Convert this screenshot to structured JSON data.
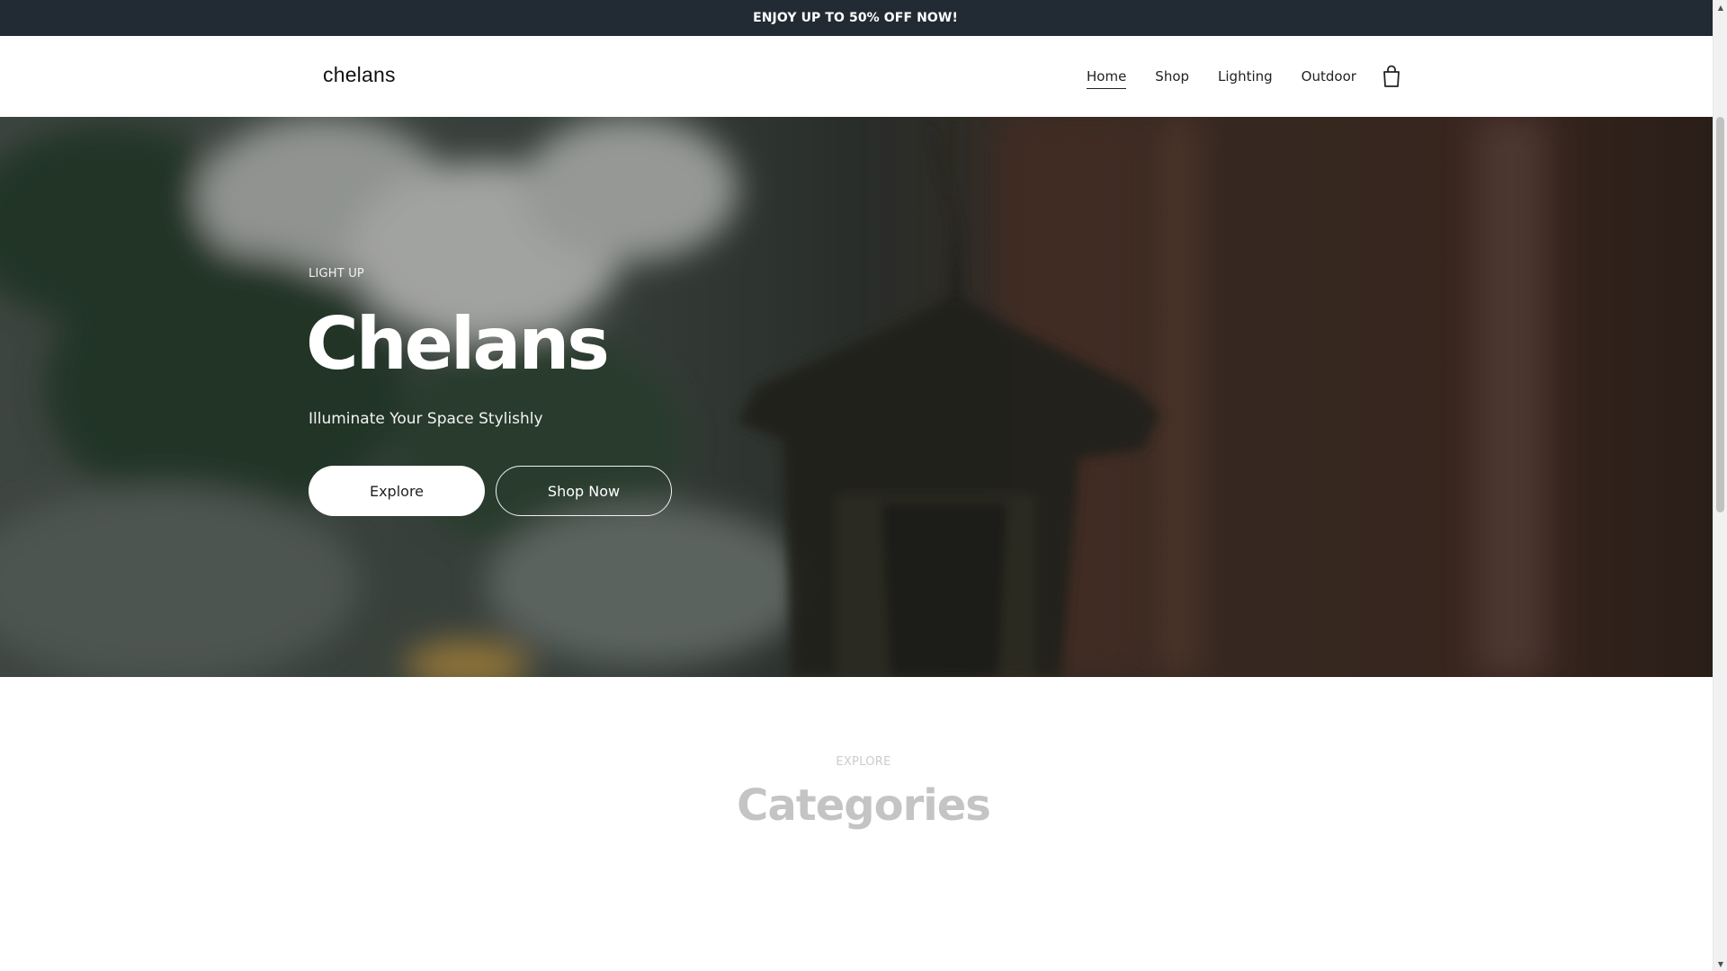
{
  "announcement": {
    "text": "ENJOY UP TO 50% OFF NOW!"
  },
  "header": {
    "logo": "chelans",
    "nav": [
      {
        "label": "Home",
        "active": true
      },
      {
        "label": "Shop",
        "active": false
      },
      {
        "label": "Lighting",
        "active": false
      },
      {
        "label": "Outdoor",
        "active": false
      }
    ],
    "cart_icon": "shopping-bag-icon"
  },
  "hero": {
    "eyebrow": "LIGHT UP",
    "title": "Chelans",
    "subtitle": "Illuminate Your Space Stylishly",
    "buttons": {
      "explore": "Explore",
      "shop_now": "Shop Now"
    }
  },
  "categories": {
    "eyebrow": "EXPLORE",
    "title": "Categories"
  },
  "colors": {
    "announcement_bg": "#222b33",
    "header_bg": "#ffffff",
    "text_dark": "#222222",
    "section_text_muted": "#c4c4c4"
  }
}
